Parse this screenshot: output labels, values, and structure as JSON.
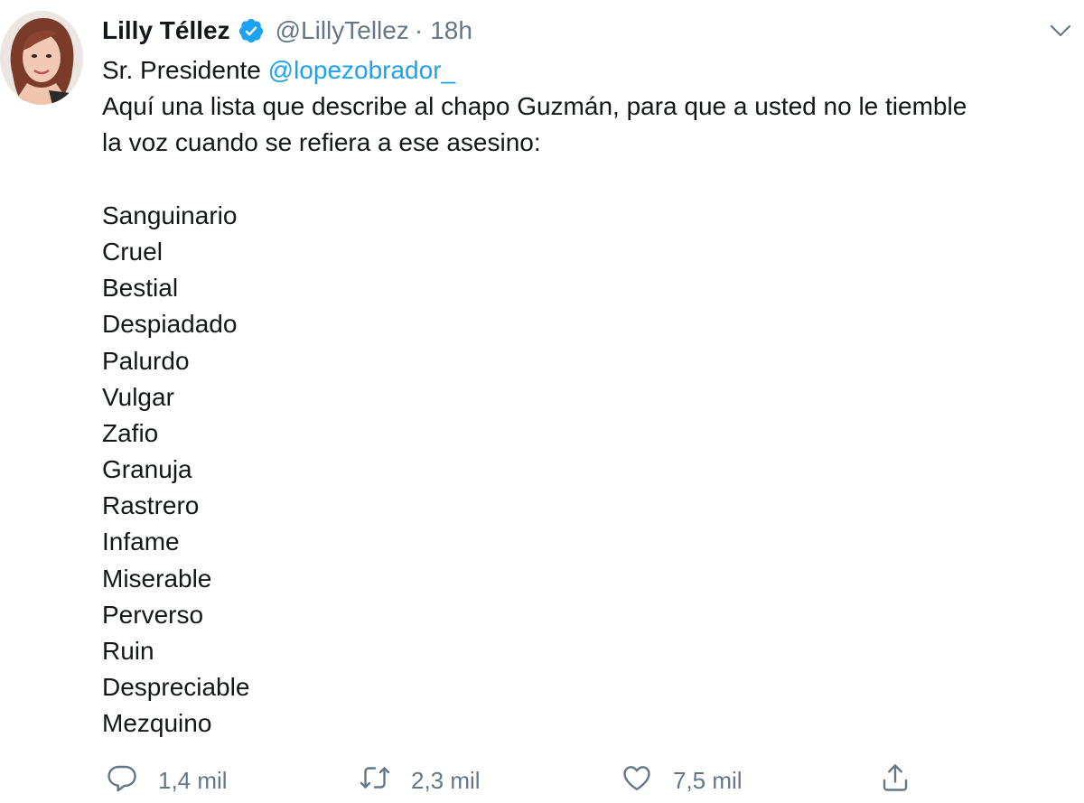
{
  "tweet": {
    "author_name": "Lilly Téllez",
    "handle": "@LillyTellez",
    "separator": "·",
    "time": "18h",
    "verified": true,
    "greeting": "Sr. Presidente ",
    "mention": "@lopezobrador_",
    "line1": "Aquí una lista que describe al chapo Guzmán, para que a usted no le tiemble",
    "line2": "la voz cuando se refiera a ese asesino:",
    "list": [
      "Sanguinario",
      "Cruel",
      "Bestial",
      "Despiadado",
      "Palurdo",
      "Vulgar",
      "Zafio",
      "Granuja",
      "Rastrero",
      "Infame",
      "Miserable",
      "Perverso",
      "Ruin",
      "Despreciable",
      "Mezquino"
    ]
  },
  "actions": {
    "reply_count": "1,4 mil",
    "retweet_count": "2,3 mil",
    "like_count": "7,5 mil"
  },
  "colors": {
    "text": "#14171a",
    "secondary": "#657786",
    "link": "#1da1f2",
    "verified": "#1da1f2"
  },
  "icons": {
    "verified": "verified-badge-icon",
    "menu": "chevron-down-icon",
    "reply": "reply-bubble-icon",
    "retweet": "retweet-arrows-icon",
    "like": "heart-outline-icon",
    "share": "share-arrow-up-icon"
  }
}
